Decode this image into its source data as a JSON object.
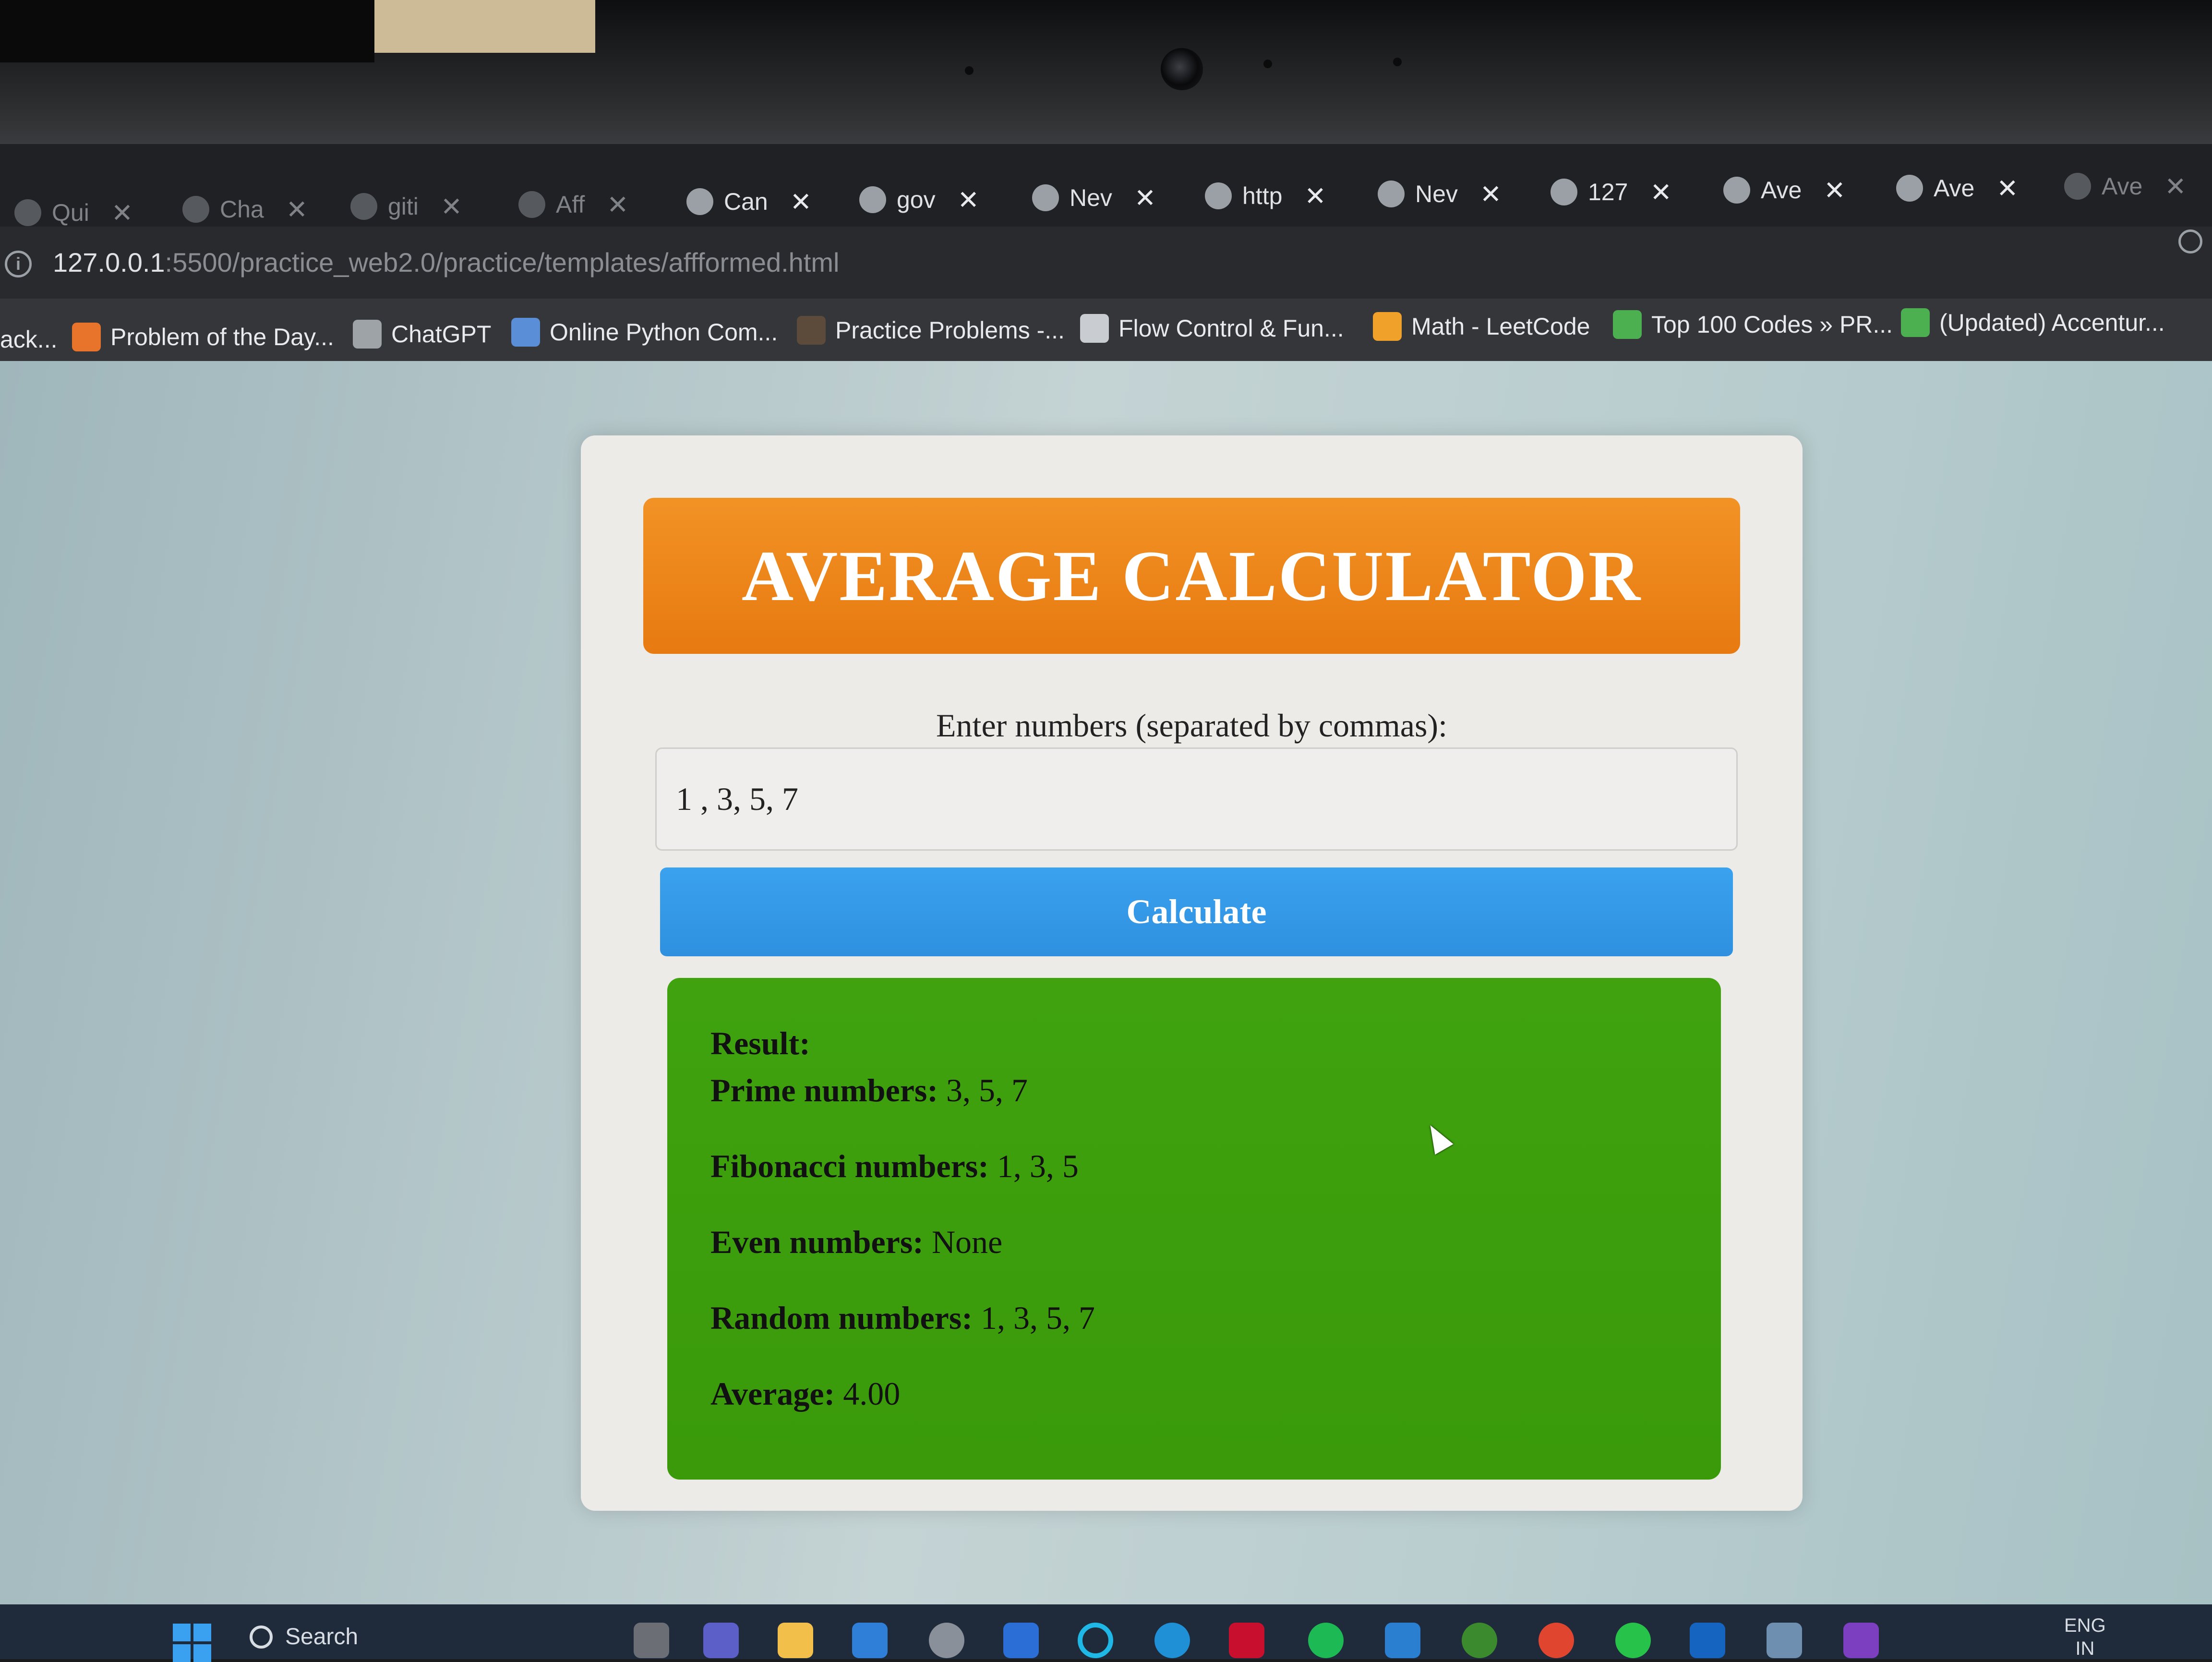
{
  "browser": {
    "tabs": [
      {
        "label": "Qui",
        "icon": "react-icon",
        "faded": true
      },
      {
        "label": "Cha",
        "icon": "chatgpt-icon",
        "faded": true
      },
      {
        "label": "giti",
        "icon": "google-icon",
        "faded": true
      },
      {
        "label": "Aff",
        "icon": "youtube-icon",
        "faded": true
      },
      {
        "label": "Can",
        "icon": "docs-icon",
        "faded": false
      },
      {
        "label": "gov",
        "icon": "github-icon",
        "faded": false
      },
      {
        "label": "Nev",
        "icon": "globe-icon",
        "faded": false
      },
      {
        "label": "http",
        "icon": "postman-icon",
        "faded": false
      },
      {
        "label": "Nev",
        "icon": "globe-icon",
        "faded": false
      },
      {
        "label": "127",
        "icon": "globe-icon",
        "faded": false
      },
      {
        "label": "Ave",
        "icon": "globe-icon",
        "faded": false
      },
      {
        "label": "Ave",
        "icon": "globe-icon",
        "faded": false
      },
      {
        "label": "Ave",
        "icon": "globe-icon",
        "faded": true
      }
    ],
    "close_glyph": "✕",
    "url_host": "127.0.0.1",
    "url_path": ":5500/practice_web2.0/practice/templates/affformed.html",
    "bookmarks": [
      {
        "label": "ack...",
        "icon": ""
      },
      {
        "label": "Problem of the Day...",
        "icon": "gfg-icon"
      },
      {
        "label": "ChatGPT",
        "icon": "chatgpt-icon"
      },
      {
        "label": "Online Python Com...",
        "icon": "bolt-icon"
      },
      {
        "label": "Practice Problems -...",
        "icon": "cc-icon"
      },
      {
        "label": "Flow Control & Fun...",
        "icon": "mountain-icon"
      },
      {
        "label": "Math - LeetCode",
        "icon": "leetcode-icon"
      },
      {
        "label": "Top 100 Codes » PR...",
        "icon": "prepinsta-icon"
      },
      {
        "label": "(Updated) Accentur...",
        "icon": "prepinsta-icon"
      }
    ]
  },
  "app": {
    "title": "AVERAGE CALCULATOR",
    "input_label": "Enter numbers (separated by commas):",
    "input_value": "1 , 3, 5, 7",
    "calculate_label": "Calculate",
    "result": {
      "heading": "Result:",
      "prime_label": "Prime numbers:",
      "prime_value": "3, 5, 7",
      "fib_label": "Fibonacci numbers:",
      "fib_value": "1, 3, 5",
      "even_label": "Even numbers:",
      "even_value": "None",
      "random_label": "Random numbers:",
      "random_value": "1, 3, 5, 7",
      "average_label": "Average:",
      "average_value": "4.00"
    }
  },
  "taskbar": {
    "search_label": "Search",
    "lang": "ENG",
    "region": "IN"
  },
  "colors": {
    "header_orange": "#f0891c",
    "button_blue": "#3399e8",
    "result_green": "#3fa00d"
  }
}
